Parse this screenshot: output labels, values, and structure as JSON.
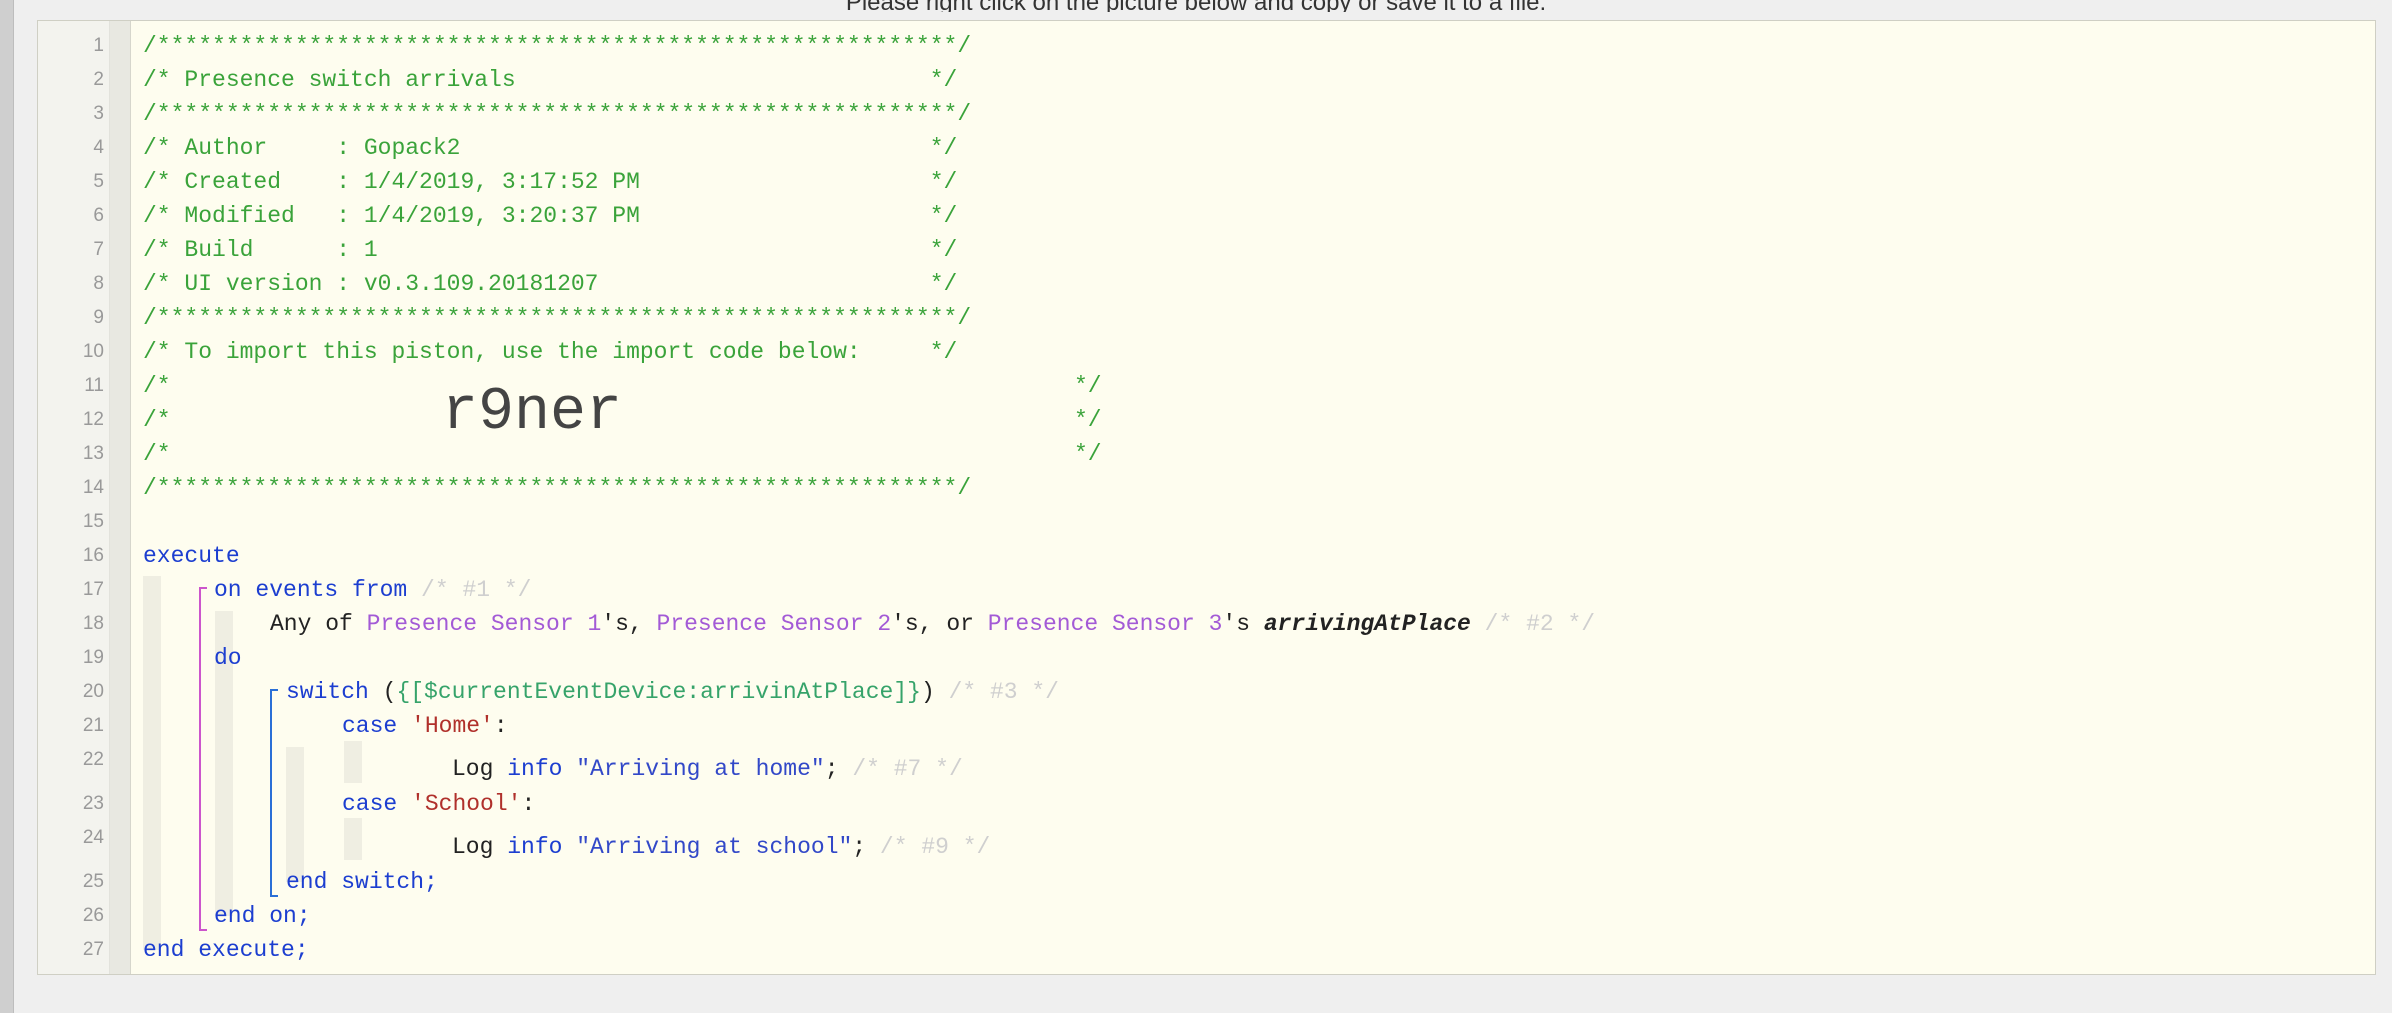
{
  "top_note": "Please right click on the picture below and copy or save it to a file.",
  "line_numbers": [
    "1",
    "2",
    "3",
    "4",
    "5",
    "6",
    "7",
    "8",
    "9",
    "10",
    "11",
    "12",
    "13",
    "14",
    "15",
    "16",
    "17",
    "18",
    "19",
    "20",
    "21",
    "22",
    "23",
    "24",
    "25",
    "26",
    "27"
  ],
  "header": {
    "l1": "/**********************************************************/",
    "l2": "/* Presence switch arrivals                              */",
    "l3": "/**********************************************************/",
    "l4": "/* Author     : Gopack2                                  */",
    "l5": "/* Created    : 1/4/2019, 3:17:52 PM                     */",
    "l6": "/* Modified   : 1/4/2019, 3:20:37 PM                     */",
    "l7": "/* Build      : 1                                        */",
    "l8": "/* UI version : v0.3.109.20181207                        */",
    "l9": "/**********************************************************/",
    "l10": "/* To import this piston, use the import code below:     */",
    "l11_left": "/*",
    "l11_right": "*/",
    "l12_left": "/*",
    "import_code": "r9ner",
    "l12_right": "*/",
    "l13_left": "/*",
    "l13_right": "*/",
    "l14": "/**********************************************************/"
  },
  "code": {
    "execute": "execute",
    "on_events": "on events from",
    "c1": "/* #1 */",
    "any_of": "Any of ",
    "dev1": "Presence Sensor 1",
    "poss1": "'s, ",
    "dev2": "Presence Sensor 2",
    "poss2": "'s, or ",
    "dev3": "Presence Sensor 3",
    "poss3": "'s ",
    "attribute": "arrivingAtPlace",
    "c2": "/* #2 */",
    "do": "do",
    "switch": "switch",
    "paren_open": " (",
    "expr": "{[$currentEventDevice:arrivinAtPlace]}",
    "paren_close": ")",
    "c3": "/* #3 */",
    "case": "case",
    "case1": "'Home'",
    "colon": ":",
    "log": "Log ",
    "info": "info",
    "msg1": "\"Arriving at home\"",
    "semi": ";",
    "c7": "/* #7 */",
    "case2": "'School'",
    "msg2": "\"Arriving at school\"",
    "c9": "/* #9 */",
    "end_switch": "end switch;",
    "end_on": "end on;",
    "end_execute": "end execute;"
  },
  "colors": {
    "comment": "#3aa33a",
    "keyword": "#1c3ed0",
    "device": "#a35ad6",
    "string": "#3248c8",
    "case_value": "#b0302b",
    "bracket_on": "#cc55cc",
    "bracket_switch": "#2a6fd6"
  }
}
